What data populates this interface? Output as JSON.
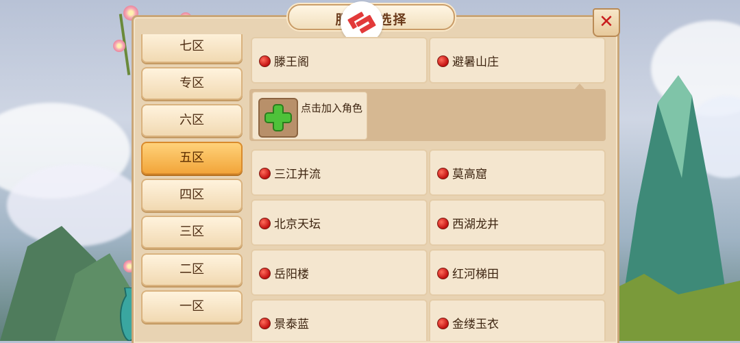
{
  "dialog": {
    "title": "服务器选择",
    "close_icon": "close-icon"
  },
  "zones": [
    {
      "label": "七区",
      "active": false
    },
    {
      "label": "专区",
      "active": false
    },
    {
      "label": "六区",
      "active": false
    },
    {
      "label": "五区",
      "active": true
    },
    {
      "label": "四区",
      "active": false
    },
    {
      "label": "三区",
      "active": false
    },
    {
      "label": "二区",
      "active": false
    },
    {
      "label": "一区",
      "active": false
    }
  ],
  "servers_top": [
    {
      "name": "滕王阁"
    },
    {
      "name": "避暑山庄"
    }
  ],
  "add_role": {
    "label": "点击加入角色",
    "icon": "plus-icon"
  },
  "servers": [
    {
      "name": "三江并流"
    },
    {
      "name": "莫高窟"
    },
    {
      "name": "北京天坛"
    },
    {
      "name": "西湖龙井"
    },
    {
      "name": "岳阳楼"
    },
    {
      "name": "红河梯田"
    },
    {
      "name": "景泰蓝"
    },
    {
      "name": "金缕玉衣"
    }
  ],
  "colors": {
    "status_dot": "#d41a1a",
    "active_tab": "#f2a53a",
    "panel_bg": "#e8d3b3",
    "plus_green": "#4ec23a"
  }
}
